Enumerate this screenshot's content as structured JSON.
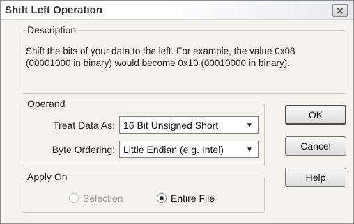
{
  "window": {
    "title": "Shift Left Operation",
    "close_icon": "close-icon"
  },
  "description": {
    "legend": "Description",
    "text": "Shift the bits of your data to the left.  For example, the value 0x08 (00001000 in binary) would become 0x10 (00010000 in binary)."
  },
  "operand": {
    "legend": "Operand",
    "treat_label": "Treat Data As:",
    "treat_value": "16 Bit Unsigned Short",
    "byte_label": "Byte Ordering:",
    "byte_value": "Little Endian (e.g. Intel)"
  },
  "buttons": {
    "ok": "OK",
    "cancel": "Cancel",
    "help": "Help"
  },
  "apply_on": {
    "legend": "Apply On",
    "selection": "Selection",
    "selection_checked": false,
    "selection_enabled": false,
    "entire_file": "Entire File",
    "entire_file_checked": true
  }
}
